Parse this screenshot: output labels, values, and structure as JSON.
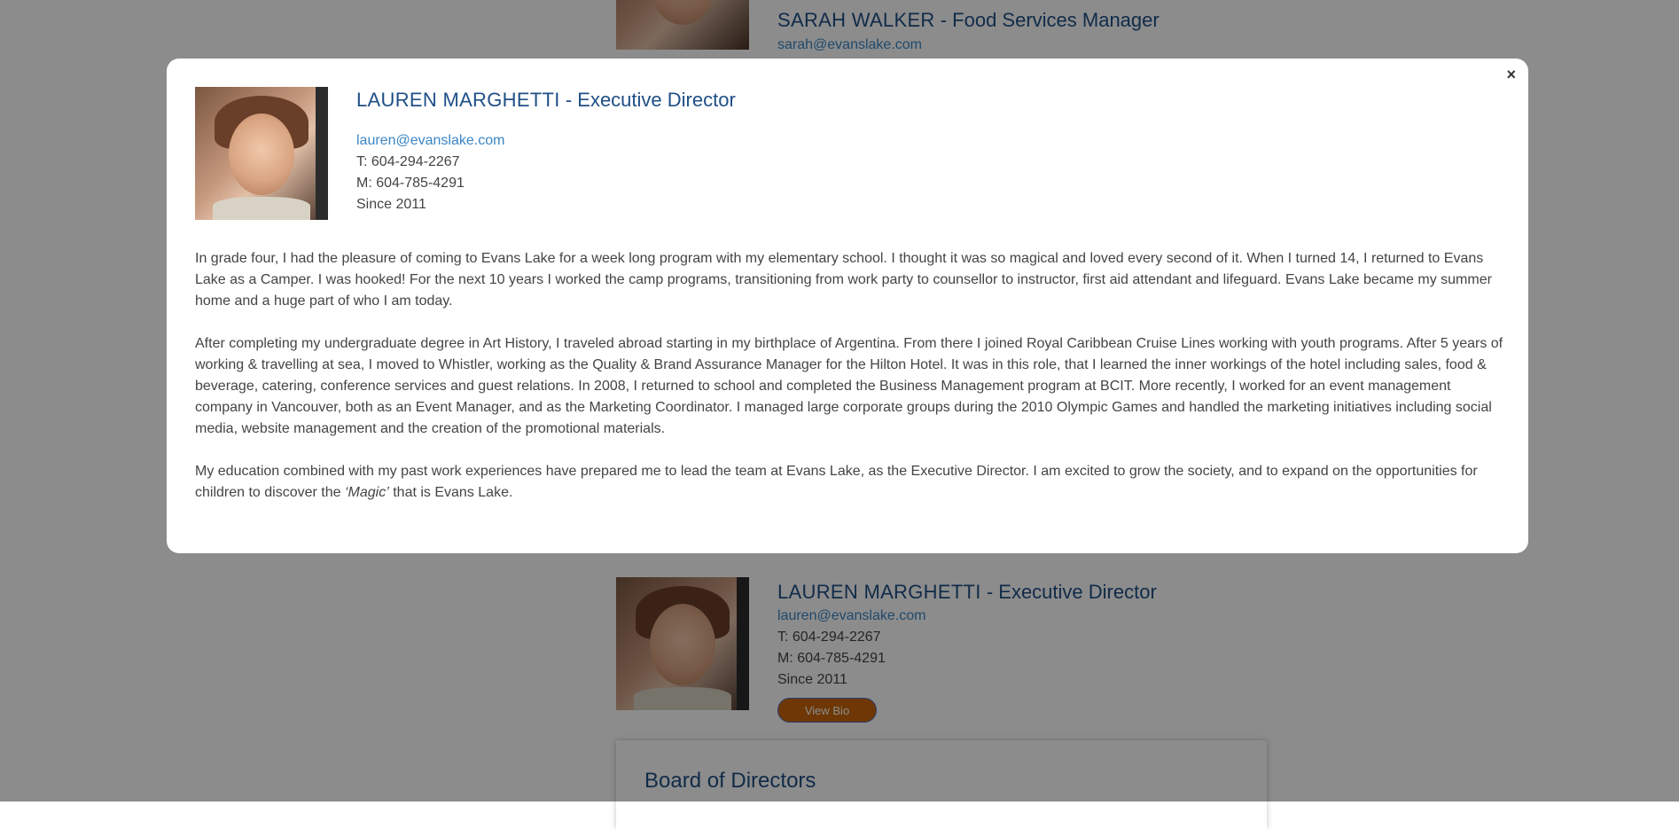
{
  "background_cards": {
    "sarah": {
      "name": "SARAH WALKER",
      "role": " - Food Services Manager",
      "email": "sarah@evanslake.com"
    },
    "lauren": {
      "name": "LAUREN MARGHETTI",
      "role": " - Executive Director",
      "email": "lauren@evanslake.com",
      "phone": "T: 604-294-2267",
      "mobile": "M: 604-785-4291",
      "since": "Since 2011",
      "button_label": "View Bio"
    },
    "board_heading": "Board of Directors"
  },
  "modal": {
    "close_icon": "×",
    "name": "LAUREN MARGHETTI",
    "role": " - Executive Director",
    "email": "lauren@evanslake.com",
    "phone": "T: 604-294-2267",
    "mobile": "M: 604-785-4291",
    "since": "Since 2011",
    "bio_p1": "In grade four,  I had the pleasure of coming to Evans Lake for a week long program with my elementary school. I thought it was so magical and loved every second of it. When I turned 14, I returned to Evans Lake as a Camper. I was hooked! For the next 10 years I worked the camp programs, transitioning from work party to counsellor to instructor, first aid attendant and lifeguard. Evans Lake became my summer home and a huge part of who I am today.",
    "bio_p2": "After completing my undergraduate degree in Art History, I traveled abroad starting in my birthplace of Argentina. From there I joined Royal Caribbean Cruise Lines working with youth programs. After 5 years of working & travelling at sea, I moved to Whistler, working as the Quality & Brand Assurance Manager for the Hilton Hotel. It was in this role, that I learned the inner workings of the hotel including sales, food & beverage, catering, conference services and guest relations. In 2008, I returned to school and completed the Business Management program at BCIT. More recently, I worked for an event management company in Vancouver, both as an Event Manager, and as the Marketing Coordinator. I managed large corporate groups during the 2010 Olympic Games and handled the marketing initiatives including social media, website management and the creation of the promotional materials.",
    "bio_p3_start": "My education combined with my past work experiences have prepared me to lead the team at Evans Lake,  as the Executive Director. I am excited to grow the society, and to expand on the opportunities for children to discover the ",
    "bio_p3_em": "‘Magic’",
    "bio_p3_end": " that is Evans Lake."
  }
}
